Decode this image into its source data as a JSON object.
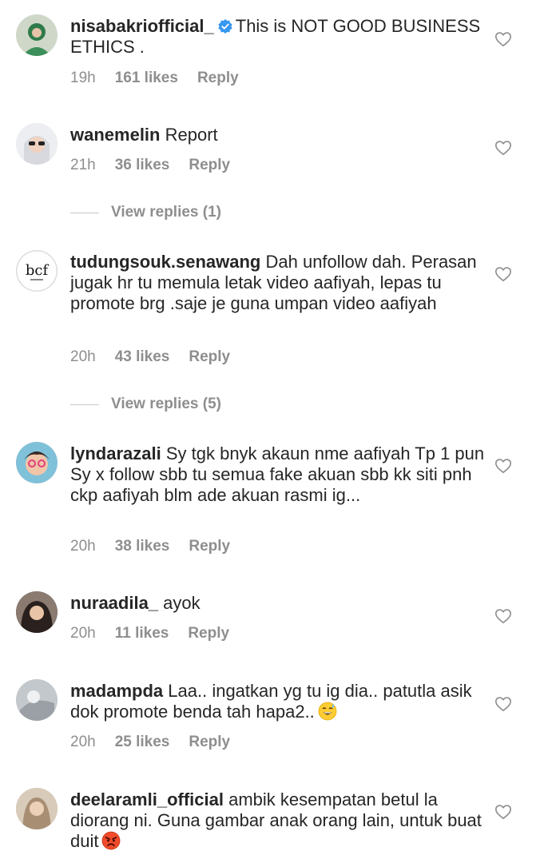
{
  "comments": [
    {
      "username": "nisabakriofficial_",
      "verified": true,
      "text": "This is NOT GOOD BUSINESS ETHICS .",
      "time": "19h",
      "likes": "161 likes",
      "reply": "Reply",
      "avatar_color": "#4a8a5c"
    },
    {
      "username": "wanemelin",
      "text": "Report",
      "time": "21h",
      "likes": "36 likes",
      "reply": "Reply",
      "avatar_color": "#d9dde3"
    },
    {
      "username": "tudungsouk.senawang",
      "text": "Dah unfollow dah. Perasan jugak hr tu memula letak video aafiyah, lepas tu promote brg .saje je guna umpan video aafiyah",
      "time": "20h",
      "likes": "43 likes",
      "reply": "Reply",
      "avatar_color": "#ffffff"
    },
    {
      "username": "lyndarazali",
      "text": "Sy tgk bnyk akaun nme aafiyah Tp 1 pun Sy x follow sbb tu semua fake akuan sbb kk siti pnh ckp aafiyah blm ade akuan rasmi ig...",
      "time": "20h",
      "likes": "38 likes",
      "reply": "Reply",
      "avatar_color": "#e57aa3"
    },
    {
      "username": "nuraadila_",
      "text": "ayok",
      "time": "20h",
      "likes": "11 likes",
      "reply": "Reply",
      "avatar_color": "#4a3a34"
    },
    {
      "username": "madampda",
      "text": "Laa.. ingatkan yg tu ig dia.. patutla asik dok promote benda tah hapa2..",
      "emoji": "sweat-smile-emoji",
      "time": "20h",
      "likes": "25 likes",
      "reply": "Reply",
      "avatar_color": "#9ea3a8"
    },
    {
      "username": "deelaramli_official",
      "text": "ambik kesempatan betul la diorang ni. Guna gambar anak orang lain, untuk buat duit",
      "emoji": "angry-face-emoji",
      "avatar_color": "#b9a58f"
    }
  ],
  "view_replies": [
    {
      "label": "View replies (1)"
    },
    {
      "label": "View replies (5)"
    }
  ],
  "icons": {
    "like": "heart-outline-icon",
    "verified": "verified-badge-icon"
  },
  "colors": {
    "text": "#262626",
    "meta": "#8e8e8e",
    "verified": "#3897f0"
  }
}
